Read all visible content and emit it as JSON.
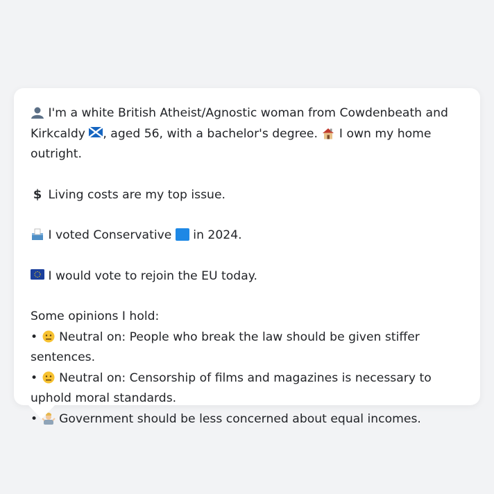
{
  "message": {
    "intro_line": "I'm a white British Atheist/Agnostic woman from Cowdenbeath and Kirkcaldy",
    "intro_line_2": ", aged 56, with a bachelor's degree.",
    "home_text": "I own my home outright.",
    "top_issue": "Living costs are my top issue.",
    "vote_prefix": "I voted Conservative",
    "vote_suffix": "in 2024.",
    "eu_text": "I would vote to rejoin the EU today.",
    "opinions_heading": "Some opinions I hold:",
    "opinions": [
      {
        "bullet": "•",
        "stance": "Neutral on:",
        "text": "People who break the law should be given stiffer sentences."
      },
      {
        "bullet": "•",
        "stance": "Neutral on:",
        "text": "Censorship of films and magazines is necessary to uphold moral standards."
      },
      {
        "bullet": "•",
        "stance": "",
        "text": "Government should be less concerned about equal incomes."
      }
    ]
  },
  "icons": {
    "person": "person-silhouette-icon",
    "scotland_flag": "scotland-flag-icon",
    "house": "house-icon",
    "dollar": "dollar-sign-icon",
    "ballot_box": "ballot-box-icon",
    "blue_square": "blue-square-icon",
    "eu_flag": "eu-flag-icon",
    "neutral_face": "neutral-face-icon",
    "shrug": "shrug-icon"
  },
  "colors": {
    "background": "#f2f3f5",
    "bubble": "#ffffff",
    "text": "#222428",
    "conservative_blue": "#1e88e5"
  }
}
